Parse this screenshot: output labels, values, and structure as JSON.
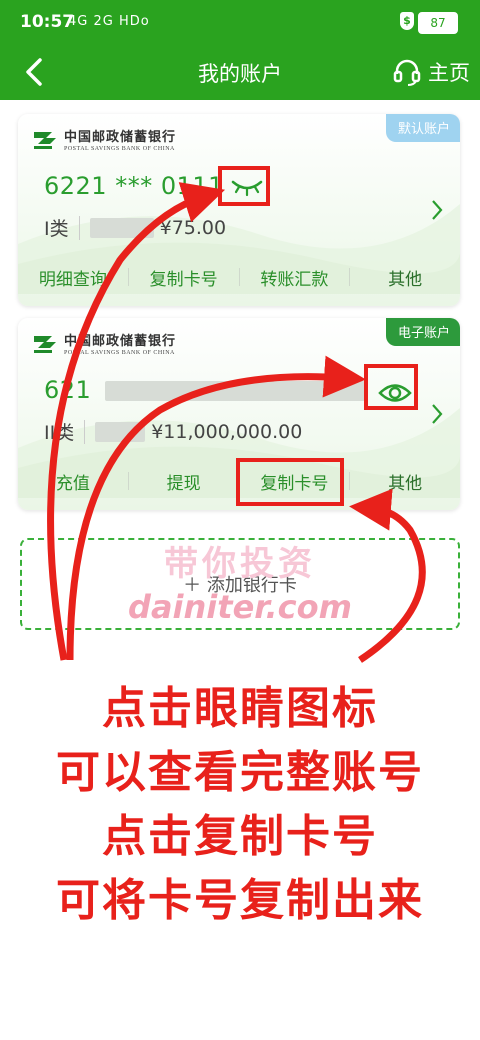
{
  "status_bar": {
    "time": "10:57",
    "network": "4G 2G HDo",
    "battery": "87",
    "shield": "$"
  },
  "header": {
    "title": "我的账户",
    "home_label": "主页"
  },
  "bank": {
    "name_cn": "中国邮政储蓄银行",
    "name_en": "POSTAL SAVINGS BANK OF CHINA"
  },
  "cards": [
    {
      "tag": "默认账户",
      "number_prefix": "6221 ***",
      "number_suffix": "0111",
      "class_label": "I类",
      "amount": "¥75.00",
      "actions": [
        "明细查询",
        "复制卡号",
        "转账汇款",
        "其他"
      ]
    },
    {
      "tag": "电子账户",
      "number_prefix": "621",
      "class_label": "II类",
      "amount": "¥11,000,000.00",
      "actions": [
        "充值",
        "提现",
        "复制卡号",
        "其他"
      ]
    }
  ],
  "add_card_label": "＋ 添加银行卡",
  "watermark": {
    "line1": "带你投资",
    "line2": "dainiter.com"
  },
  "annotations": [
    "点击眼睛图标",
    "可以查看完整账号",
    "点击复制卡号",
    "可将卡号复制出来"
  ],
  "colors": {
    "brand_green": "#2aa31f",
    "annotation_red": "#e8211b"
  }
}
